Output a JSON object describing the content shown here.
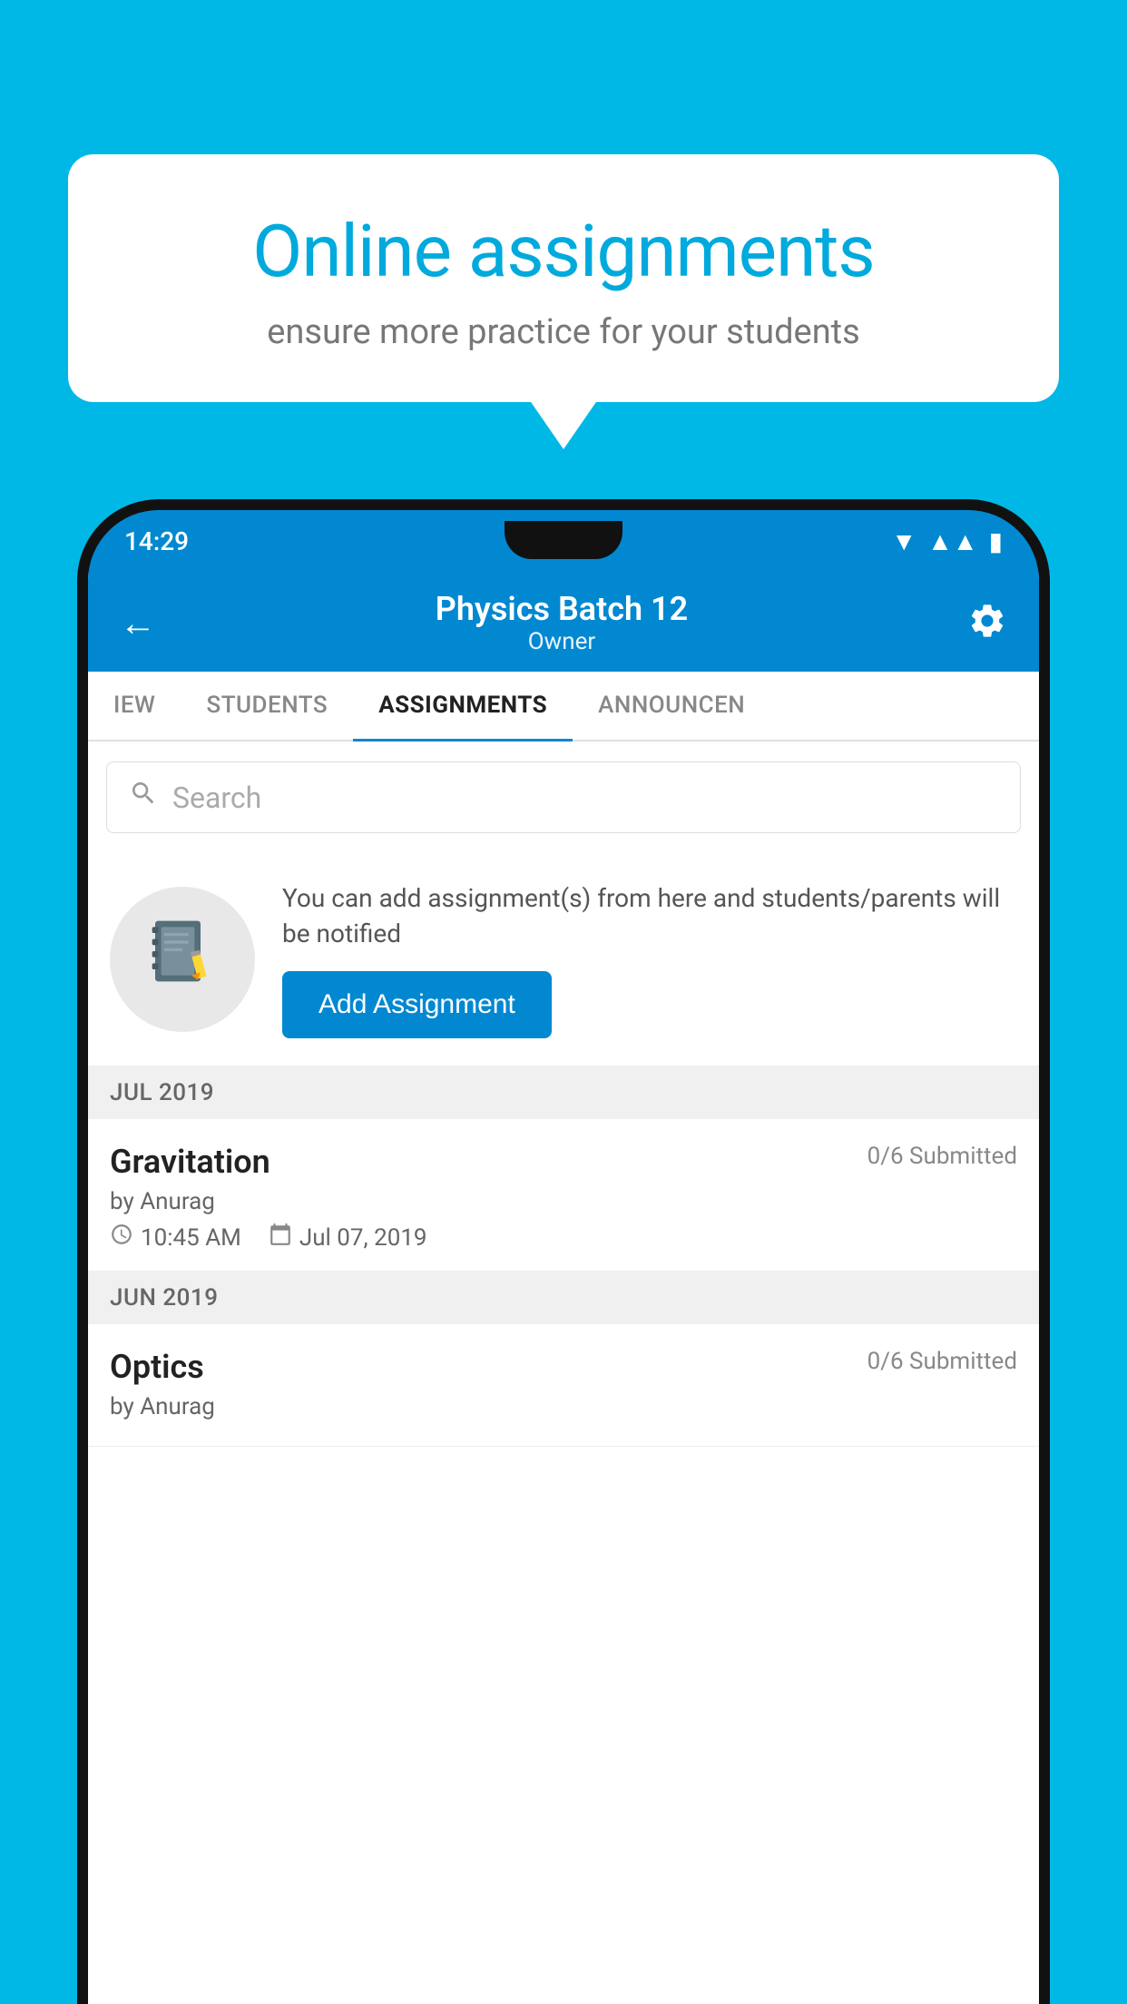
{
  "background_color": "#00b8e6",
  "speech_bubble": {
    "title": "Online assignments",
    "subtitle": "ensure more practice for your students"
  },
  "status_bar": {
    "time": "14:29",
    "wifi": "wifi-icon",
    "signal": "signal-icon",
    "battery": "battery-icon"
  },
  "app_header": {
    "back_label": "←",
    "title": "Physics Batch 12",
    "subtitle": "Owner",
    "settings_label": "settings"
  },
  "tabs": [
    {
      "label": "IEW",
      "active": false
    },
    {
      "label": "STUDENTS",
      "active": false
    },
    {
      "label": "ASSIGNMENTS",
      "active": true
    },
    {
      "label": "ANNOUNCEN",
      "active": false
    }
  ],
  "search": {
    "placeholder": "Search"
  },
  "add_assignment": {
    "description": "You can add assignment(s) from here and students/parents will be notified",
    "button_label": "Add Assignment"
  },
  "assignments": [
    {
      "month": "JUL 2019",
      "items": [
        {
          "name": "Gravitation",
          "submitted": "0/6 Submitted",
          "author": "by Anurag",
          "time": "10:45 AM",
          "date": "Jul 07, 2019"
        }
      ]
    },
    {
      "month": "JUN 2019",
      "items": [
        {
          "name": "Optics",
          "submitted": "0/6 Submitted",
          "author": "by Anurag",
          "time": "",
          "date": ""
        }
      ]
    }
  ]
}
